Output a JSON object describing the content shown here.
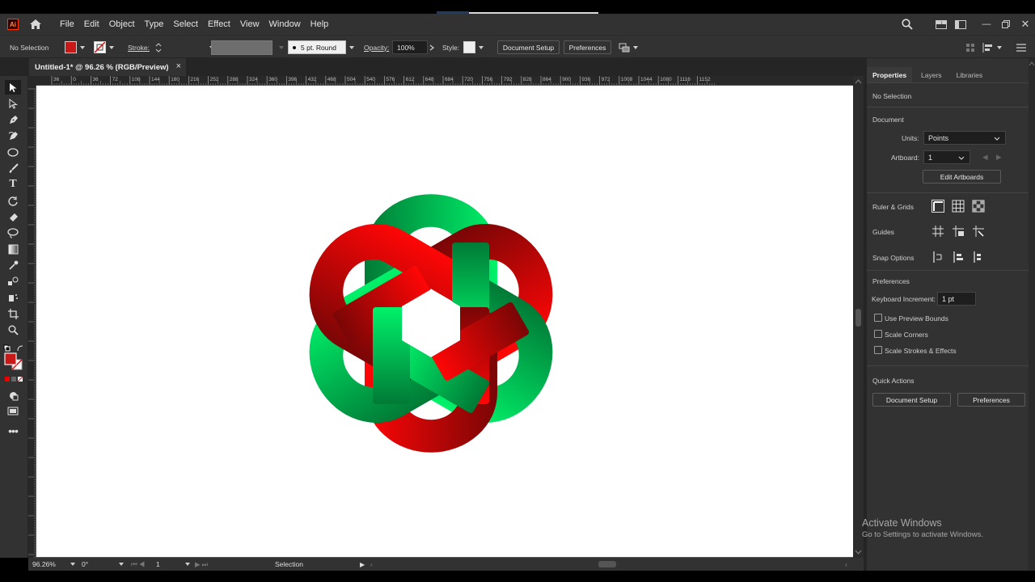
{
  "app": {
    "logo_text": "Ai",
    "accent": "#ff7c00"
  },
  "menu": {
    "items": [
      "File",
      "Edit",
      "Object",
      "Type",
      "Select",
      "Effect",
      "View",
      "Window",
      "Help"
    ]
  },
  "control_bar": {
    "selection_label": "No Selection",
    "stroke_label": "Stroke:",
    "brush_label": "5 pt. Round",
    "opacity_label": "Opacity:",
    "opacity_value": "100%",
    "style_label": "Style:",
    "document_setup": "Document Setup",
    "preferences": "Preferences",
    "fill_color": "#c81818"
  },
  "document_tab": {
    "title": "Untitled-1* @ 96.26 % (RGB/Preview)",
    "close": "×"
  },
  "ruler": {
    "h_labels": [
      "36",
      "0",
      "36",
      "72",
      "108",
      "144",
      "180",
      "216",
      "252",
      "288",
      "324",
      "360",
      "396",
      "432",
      "468",
      "504",
      "540",
      "576",
      "612",
      "648",
      "684",
      "720",
      "756",
      "792",
      "828",
      "864",
      "900",
      "936",
      "972",
      "1008",
      "1044",
      "1080",
      "1116",
      "1152"
    ]
  },
  "artwork": {
    "dark_red": "#7a0606",
    "red": "#ff0606",
    "dark_green": "#007a36",
    "green": "#00f26a"
  },
  "status_bar": {
    "zoom": "96.26%",
    "rotation": "0°",
    "artboard": "1",
    "tool": "Selection"
  },
  "panel": {
    "tabs": [
      "Properties",
      "Layers",
      "Libraries"
    ],
    "no_selection": "No Selection",
    "document_header": "Document",
    "units_label": "Units:",
    "units_value": "Points",
    "artboard_label": "Artboard:",
    "artboard_value": "1",
    "edit_artboards": "Edit Artboards",
    "ruler_grids": "Ruler & Grids",
    "guides": "Guides",
    "snap_options": "Snap Options",
    "preferences_header": "Preferences",
    "keyboard_increment_label": "Keyboard Increment:",
    "keyboard_increment_value": "1 pt",
    "use_preview_bounds": "Use Preview Bounds",
    "scale_corners": "Scale Corners",
    "scale_strokes": "Scale Strokes & Effects",
    "quick_actions": "Quick Actions",
    "qa_document_setup": "Document Setup",
    "qa_preferences": "Preferences"
  },
  "watermark": {
    "title": "Activate Windows",
    "subtitle": "Go to Settings to activate Windows."
  }
}
